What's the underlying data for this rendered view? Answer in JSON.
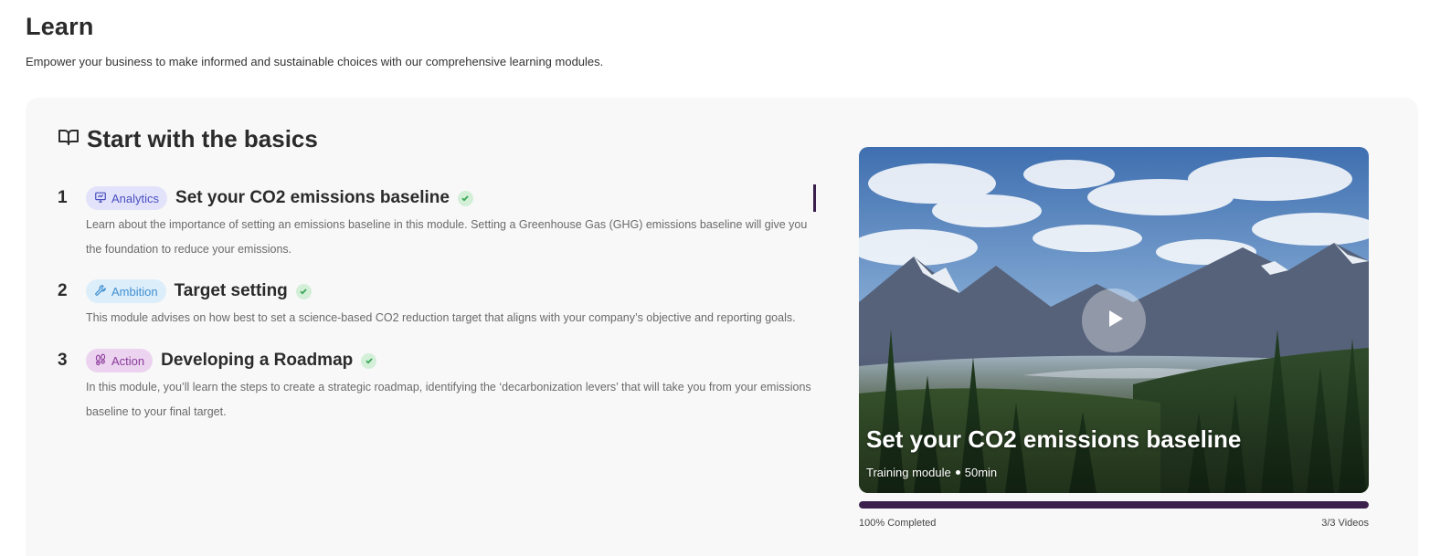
{
  "page": {
    "title": "Learn",
    "subtitle": "Empower your business to make informed and sustainable choices with our comprehensive learning modules."
  },
  "section": {
    "title": "Start with the basics",
    "icon": "book-icon"
  },
  "modules": [
    {
      "number": "1",
      "tag": "Analytics",
      "tag_icon": "presentation-icon",
      "title": "Set your CO2 emissions baseline",
      "completed": true,
      "active": true,
      "description": "Learn about the importance of setting an emissions baseline in this module. Setting a Greenhouse Gas (GHG) emissions baseline will give you the foundation to reduce your emissions."
    },
    {
      "number": "2",
      "tag": "Ambition",
      "tag_icon": "wrench-icon",
      "title": "Target setting",
      "completed": true,
      "active": false,
      "description": "This module advises on how best to set a science-based CO2 reduction target that aligns with your company’s objective and reporting goals."
    },
    {
      "number": "3",
      "tag": "Action",
      "tag_icon": "footprints-icon",
      "title": "Developing a Roadmap",
      "completed": true,
      "active": false,
      "description": "In this module, you’ll learn the steps to create a strategic roadmap, identifying the ‘decarbonization levers’ that will take you from your emissions baseline to your final target."
    }
  ],
  "video": {
    "title": "Set your CO2 emissions baseline",
    "type": "Training module",
    "duration": "50min"
  },
  "progress": {
    "label": "100% Completed",
    "count": "3/3 Videos",
    "fraction": 1.0
  },
  "colors": {
    "accent": "#3b1f4d",
    "check_bg": "#d3efd8",
    "check_mark": "#3aa655"
  }
}
